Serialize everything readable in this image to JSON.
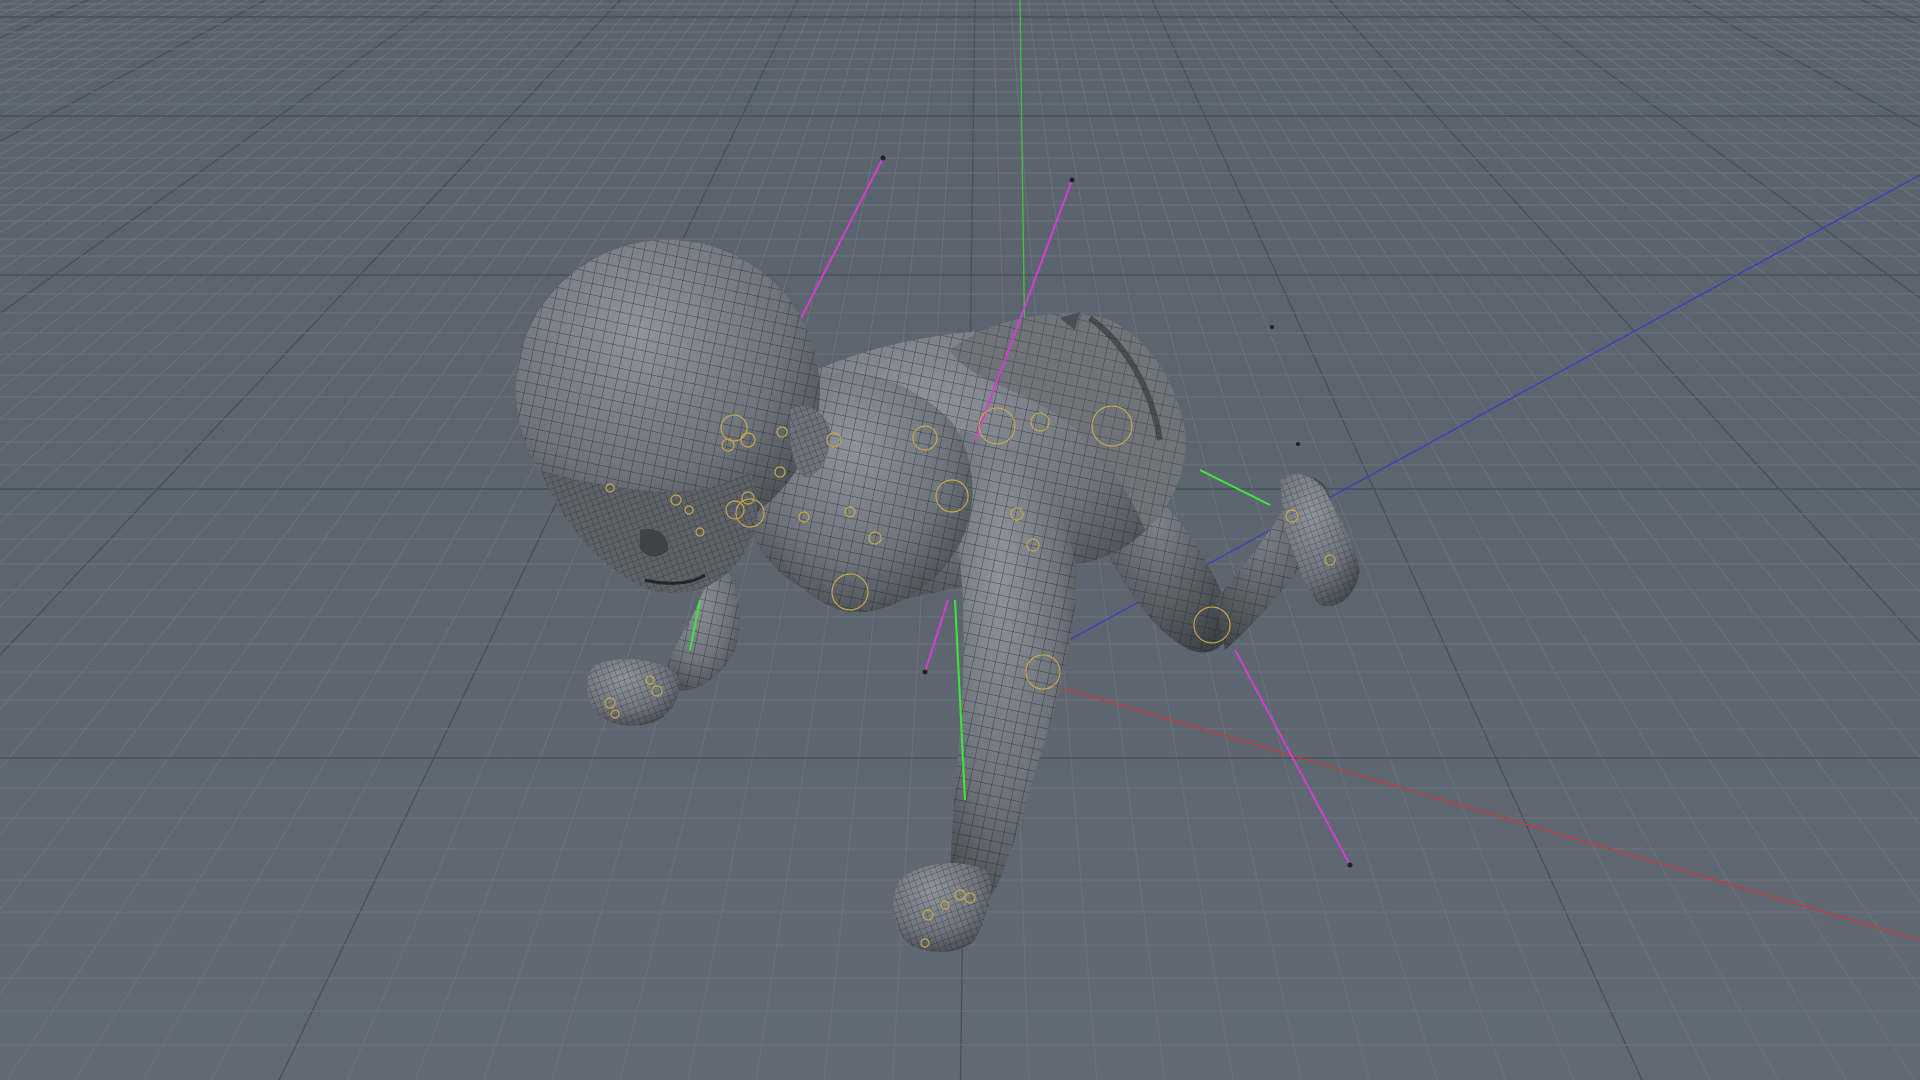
{
  "viewport": {
    "view": "perspective",
    "background_color": "#5d666f",
    "grid": {
      "visible": true,
      "minor_line_color": "#6a737c",
      "major_line_color": "#48515a"
    },
    "world_axes": {
      "x_color": "#c43c3c",
      "y_color": "#3cc43c",
      "z_color": "#3c3cc4"
    }
  },
  "scene": {
    "object": "crawling-baby-model",
    "display_mode": "shaded-wireframe",
    "mesh_color": "#7a7f86",
    "wire_color": "#1b1e22",
    "rig": {
      "ik_pole_color": "#d23ed2",
      "bone_color": "#3ee63e",
      "joint_marker_color": "#c8a646"
    }
  }
}
